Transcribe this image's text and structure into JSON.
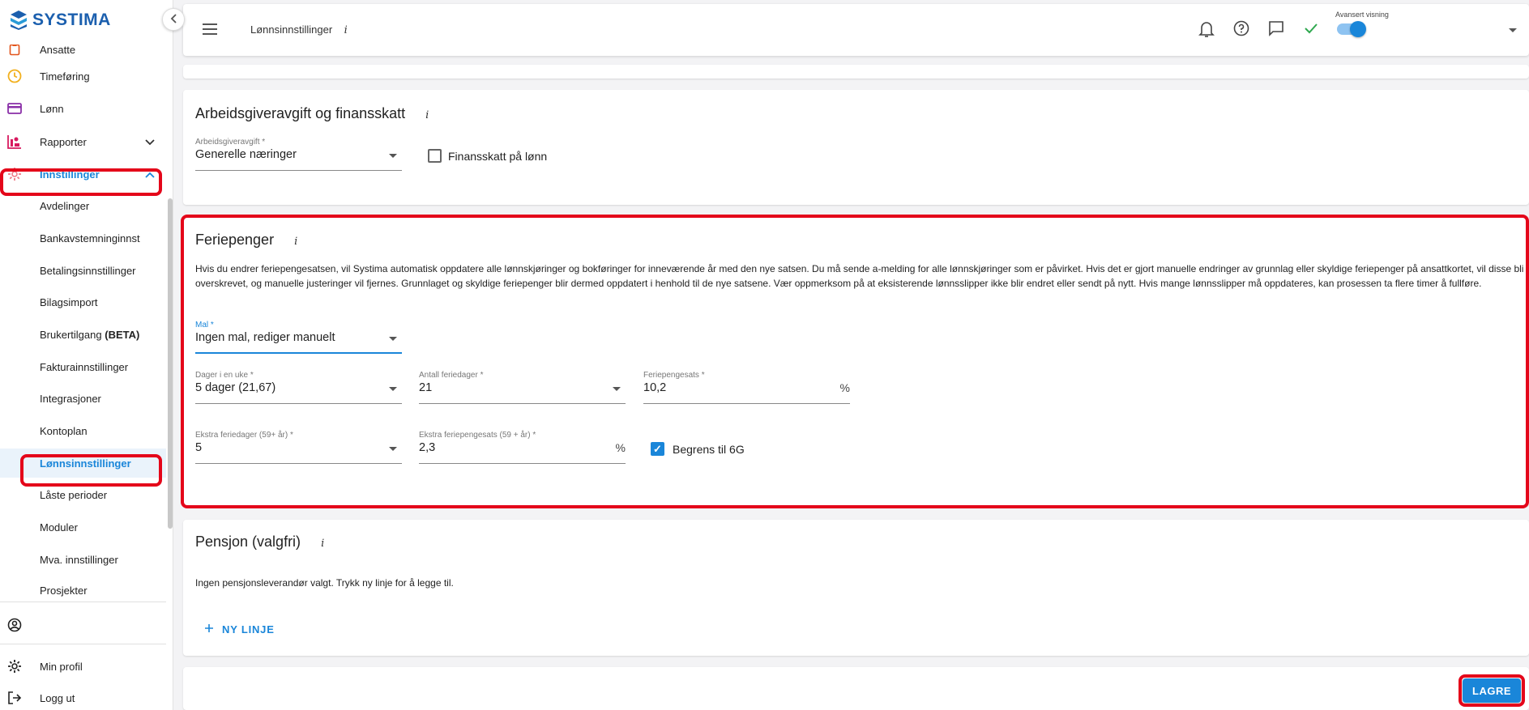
{
  "app": {
    "logo_text": "SYSTIMA"
  },
  "sidebar": {
    "items": [
      {
        "label": "Ansatte",
        "icon": "clipboard-icon"
      },
      {
        "label": "Timeføring",
        "icon": "clock-icon"
      },
      {
        "label": "Lønn",
        "icon": "credit-card-icon"
      },
      {
        "label": "Rapporter",
        "icon": "chart-icon"
      },
      {
        "label": "Innstillinger",
        "icon": "gear-icon"
      },
      {
        "label": "Avdelinger"
      },
      {
        "label": "Bankavstemninginnst"
      },
      {
        "label": "Betalingsinnstillinger"
      },
      {
        "label": "Bilagsimport"
      },
      {
        "label": "Brukertilgang",
        "suffix": "(BETA)"
      },
      {
        "label": "Fakturainnstillinger"
      },
      {
        "label": "Integrasjoner"
      },
      {
        "label": "Kontoplan"
      },
      {
        "label": "Lønnsinnstillinger"
      },
      {
        "label": "Låste perioder"
      },
      {
        "label": "Moduler"
      },
      {
        "label": "Mva. innstillinger"
      },
      {
        "label": "Prosjekter"
      }
    ],
    "bottom": {
      "profile_label": "Min profil",
      "logout_label": "Logg ut"
    }
  },
  "topbar": {
    "title": "Lønnsinnstillinger",
    "info": "i",
    "advanced_view_label": "Avansert visning",
    "advanced_view_on": true
  },
  "employer_tax": {
    "title": "Arbeidsgiveravgift og finansskatt",
    "info": "i",
    "field_label": "Arbeidsgiveravgift *",
    "field_value": "Generelle næringer",
    "finance_tax_label": "Finansskatt på lønn",
    "finance_tax_checked": false
  },
  "holiday_pay": {
    "title": "Feriepenger",
    "info": "i",
    "description": "Hvis du endrer feriepengesatsen, vil Systima automatisk oppdatere alle lønnskjøringer og bokføringer for inneværende år med den nye satsen. Du må sende a-melding for alle lønnskjøringer som er påvirket. Hvis det er gjort manuelle endringer av grunnlag eller skyldige feriepenger på ansattkortet, vil disse bli overskrevet, og manuelle justeringer vil fjernes. Grunnlaget og skyldige feriepenger blir dermed oppdatert i henhold til de nye satsene. Vær oppmerksom på at eksisterende lønnsslipper ikke blir endret eller sendt på nytt. Hvis mange lønnsslipper må oppdateres, kan prosessen ta flere timer å fullføre.",
    "template_label": "Mal *",
    "template_value": "Ingen mal, rediger manuelt",
    "days_week_label": "Dager i en uke *",
    "days_week_value": "5 dager (21,67)",
    "holiday_days_label": "Antall feriedager *",
    "holiday_days_value": "21",
    "rate_label": "Feriepengesats *",
    "rate_value": "10,2",
    "rate_unit": "%",
    "extra_days_label": "Ekstra feriedager (59+ år) *",
    "extra_days_value": "5",
    "extra_rate_label": "Ekstra feriepengesats (59 + år) *",
    "extra_rate_value": "2,3",
    "extra_rate_unit": "%",
    "limit_6g_label": "Begrens til 6G",
    "limit_6g_checked": true
  },
  "pension": {
    "title": "Pensjon (valgfri)",
    "info": "i",
    "empty_text": "Ingen pensjonsleverandør valgt. Trykk ny linje for å legge til.",
    "new_line_label": "NY LINJE"
  },
  "footer": {
    "save_label": "LAGRE"
  },
  "colors": {
    "accent": "#1a86d9",
    "highlight": "#e4061a",
    "brand": "#1b5fae"
  }
}
